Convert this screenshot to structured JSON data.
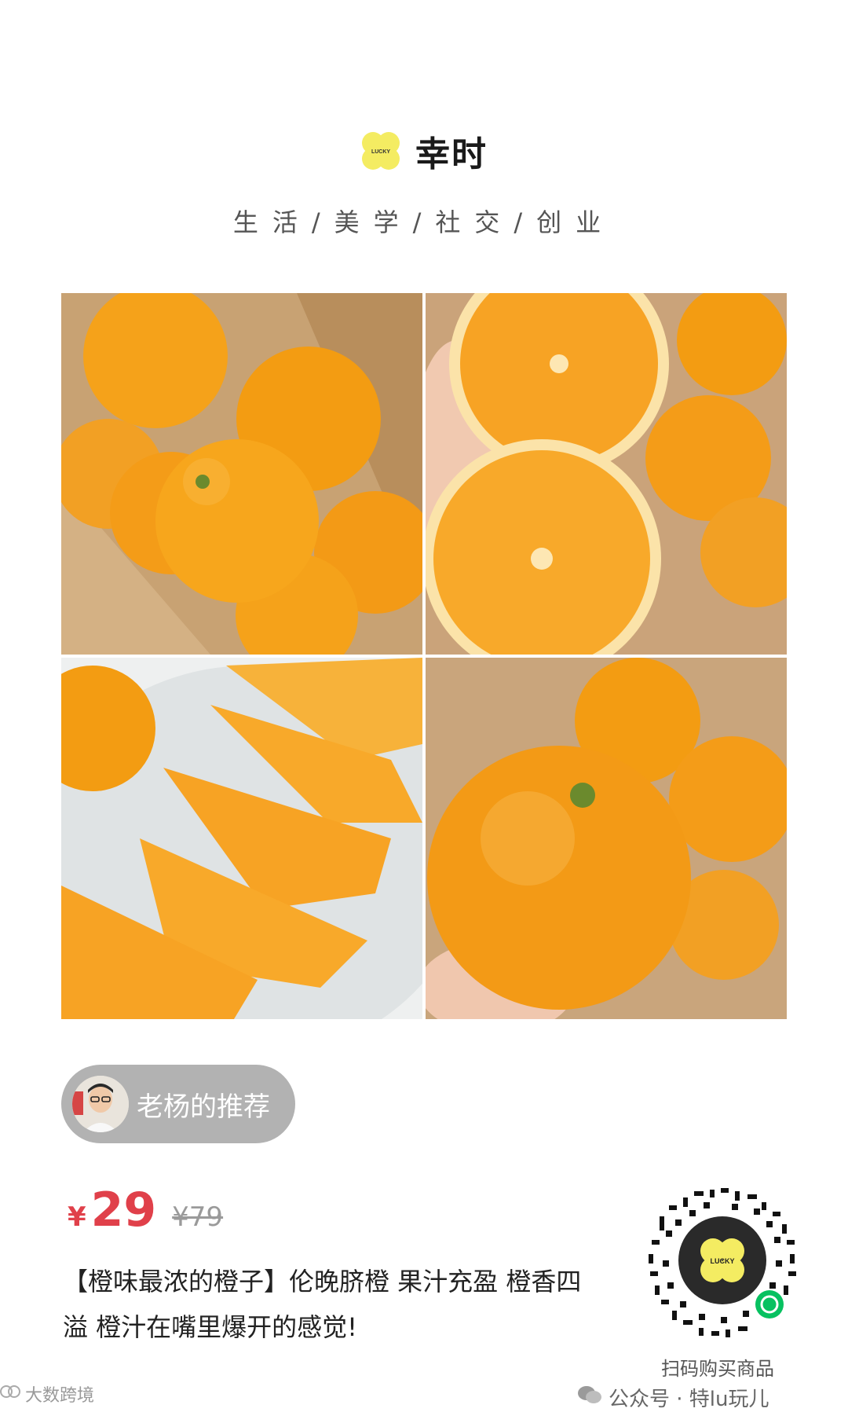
{
  "brand": {
    "name": "幸时",
    "logo_text": "LUCKY",
    "logo_color": "#f4ec62",
    "logo_icon": "lucky-clover-logo"
  },
  "tagline": "生活/美学/社交/创业",
  "gallery": {
    "images": [
      {
        "icon": "oranges-in-box-image"
      },
      {
        "icon": "halved-oranges-image"
      },
      {
        "icon": "orange-slices-plate-image"
      },
      {
        "icon": "orange-in-hand-image"
      }
    ]
  },
  "recommender": {
    "label": "老杨的推荐",
    "pill_color": "#b2b2b2"
  },
  "product": {
    "currency": "¥",
    "price": "29",
    "original_price": "¥79",
    "price_color": "#e0404a",
    "description": "【橙味最浓的橙子】伦晚脐橙 果汁充盈 橙香四溢 橙汁在嘴里爆开的感觉!"
  },
  "qr": {
    "center_text": "LUCKY",
    "caption": "扫码购买商品"
  },
  "watermarks": {
    "right": "公众号 · 特lu玩儿",
    "left": "大数跨境"
  }
}
